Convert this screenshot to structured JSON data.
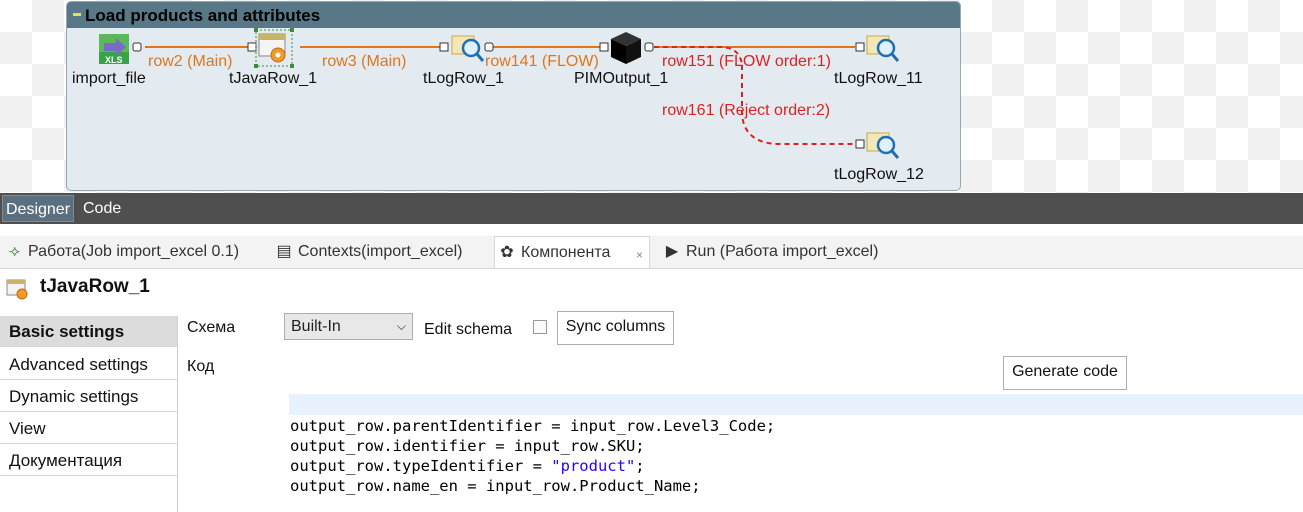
{
  "subjob": {
    "title": "Load products and attributes"
  },
  "nodes": {
    "import_file": "import_file",
    "java_row": "tJavaRow_1",
    "log_row_1": "tLogRow_1",
    "pim_output": "PIMOutput_1",
    "log_row_11": "tLogRow_11",
    "log_row_12": "tLogRow_12"
  },
  "links": {
    "row2": "row2 (Main)",
    "row3": "row3 (Main)",
    "row141": "row141 (FLOW)",
    "row151": "row151 (FLOW order:1)",
    "row161": "row161 (Reject order:2)"
  },
  "editor_tabs": {
    "designer": "Designer",
    "code": "Code"
  },
  "view_tabs": [
    {
      "label": "Работа(Job import_excel 0.1)",
      "icon": "job-icon"
    },
    {
      "label": "Contexts(import_excel)",
      "icon": "contexts-icon"
    },
    {
      "label": "Компонента",
      "icon": "palette-icon",
      "active": true
    },
    {
      "label": "Run (Работа import_excel)",
      "icon": "run-icon"
    }
  ],
  "component": {
    "title": "tJavaRow_1",
    "sidebar": [
      "Basic settings",
      "Advanced settings",
      "Dynamic settings",
      "View",
      "Документация"
    ],
    "schema_label": "Схема",
    "schema_value": "Built-In",
    "edit_schema_label": "Edit schema",
    "sync_columns": "Sync columns",
    "code_label": "Код",
    "generate_code": "Generate code",
    "code": {
      "line1": "output_row.parentIdentifier = input_row.Level3_Code;",
      "line2": "output_row.identifier = input_row.SKU;",
      "line3_pre": "output_row.typeIdentifier = ",
      "line3_str": "\"product\"",
      "line3_post": ";",
      "line4": "output_row.name_en = input_row.Product_Name;"
    }
  },
  "colors": {
    "main_link": "#e0751b",
    "reject_link": "#e01f1f",
    "subjob_header": "#587888"
  }
}
